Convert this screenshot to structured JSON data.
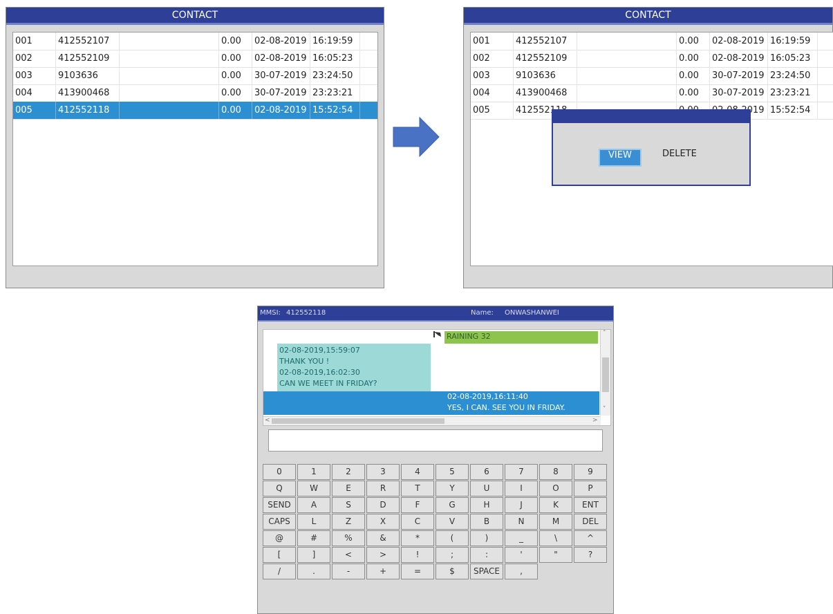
{
  "contact_panel": {
    "title": "CONTACT",
    "rows": [
      {
        "idx": "001",
        "number": "412552107",
        "value": "0.00",
        "date": "02-08-2019",
        "time": "16:19:59"
      },
      {
        "idx": "002",
        "number": "412552109",
        "value": "0.00",
        "date": "02-08-2019",
        "time": "16:05:23"
      },
      {
        "idx": "003",
        "number": "9103636",
        "value": "0.00",
        "date": "30-07-2019",
        "time": "23:24:50"
      },
      {
        "idx": "004",
        "number": "413900468",
        "value": "0.00",
        "date": "30-07-2019",
        "time": "23:23:21"
      },
      {
        "idx": "005",
        "number": "412552118",
        "value": "0.00",
        "date": "02-08-2019",
        "time": "15:52:54"
      }
    ],
    "selected_row": 4
  },
  "contact_panel_dialog": {
    "title": "CONTACT",
    "dialog": {
      "view_label": "VIEW",
      "delete_label": "DELETE"
    }
  },
  "chat": {
    "mmsi_label": "MMSI:",
    "mmsi_value": "412552118",
    "name_label": "Name:",
    "name_value": "ONWASHANWEI",
    "messages": [
      {
        "lines": [
          "RAINING 32"
        ]
      },
      {
        "lines": [
          "02-08-2019,15:59:07",
          "THANK YOU !",
          "02-08-2019,16:02:30",
          "CAN WE MEET IN FRIDAY?"
        ]
      },
      {
        "lines": [
          "02-08-2019,16:11:40",
          "YES, I CAN. SEE YOU IN FRIDAY."
        ]
      }
    ],
    "input_value": "",
    "keyboard_rows": [
      [
        "0",
        "1",
        "2",
        "3",
        "4",
        "5",
        "6",
        "7",
        "8",
        "9"
      ],
      [
        "Q",
        "W",
        "E",
        "R",
        "T",
        "Y",
        "U",
        "I",
        "O",
        "P"
      ],
      [
        "SEND",
        "A",
        "S",
        "D",
        "F",
        "G",
        "H",
        "J",
        "K",
        "ENT"
      ],
      [
        "CAPS",
        "L",
        "Z",
        "X",
        "C",
        "V",
        "B",
        "N",
        "M",
        "DEL"
      ],
      [
        "@",
        "#",
        "%",
        "&",
        "*",
        "(",
        ")",
        "_",
        "\\",
        "^"
      ],
      [
        "[",
        "]",
        "<",
        ">",
        "!",
        ";",
        ":",
        "'",
        "\"",
        "?"
      ],
      [
        "/",
        ".",
        "-",
        "+",
        "=",
        "$",
        "SPACE",
        ","
      ]
    ]
  },
  "colors": {
    "title_bar": "#2e3f97",
    "selection": "#2c8fd1",
    "bubble_green": "#8cc44c",
    "bubble_teal": "#9dd9d7"
  }
}
